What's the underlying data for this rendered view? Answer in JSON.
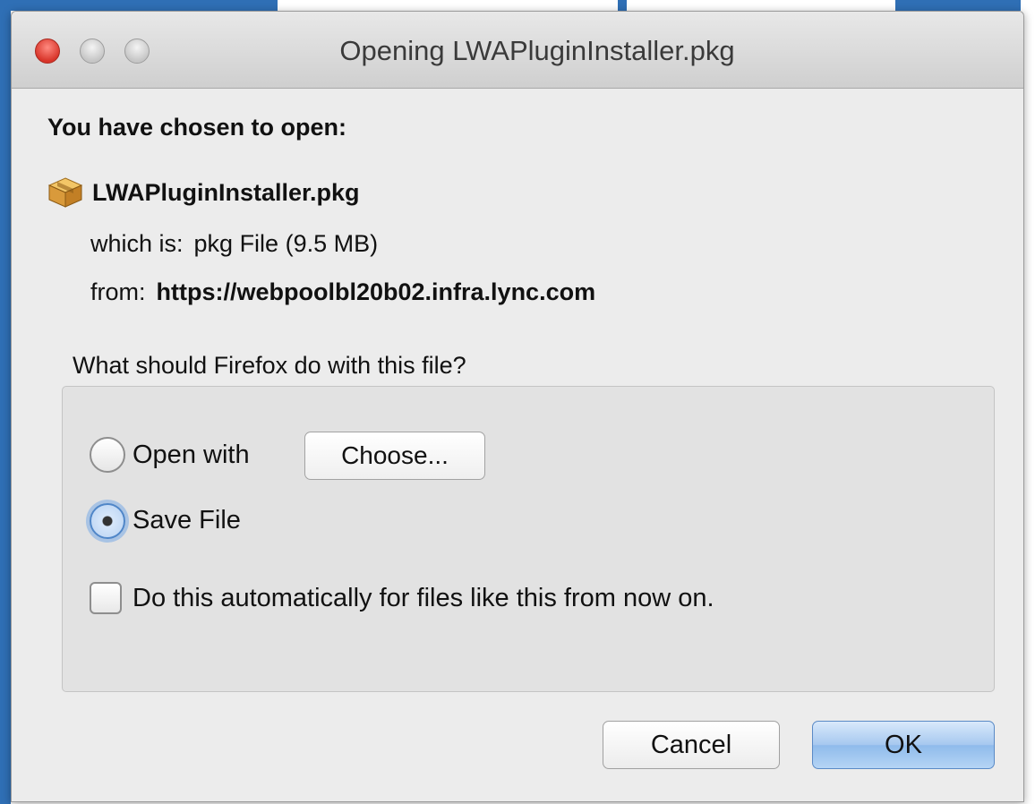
{
  "window": {
    "title": "Opening LWAPluginInstaller.pkg"
  },
  "dialog": {
    "intro": "You have chosen to open:",
    "file_name": "LWAPluginInstaller.pkg",
    "type_label": "which is:",
    "type_value": "pkg File (9.5 MB)",
    "from_label": "from:",
    "from_value": "https://webpoolbl20b02.infra.lync.com",
    "question": "What should Firefox do with this file?"
  },
  "options": {
    "open_with_label": "Open with",
    "open_with_checked": false,
    "choose_label": "Choose...",
    "save_file_label": "Save File",
    "save_file_checked": true,
    "auto_label": "Do this automatically for files like this from now on.",
    "auto_checked": false
  },
  "buttons": {
    "cancel": "Cancel",
    "ok": "OK"
  },
  "colors": {
    "default_button": "#a6c8ef",
    "selection_focus": "#4f86c8",
    "close_button": "#d8352a"
  },
  "icons": {
    "window_close": "close-icon",
    "window_minimize": "minimize-icon",
    "window_zoom": "zoom-icon",
    "package": "package-icon"
  }
}
